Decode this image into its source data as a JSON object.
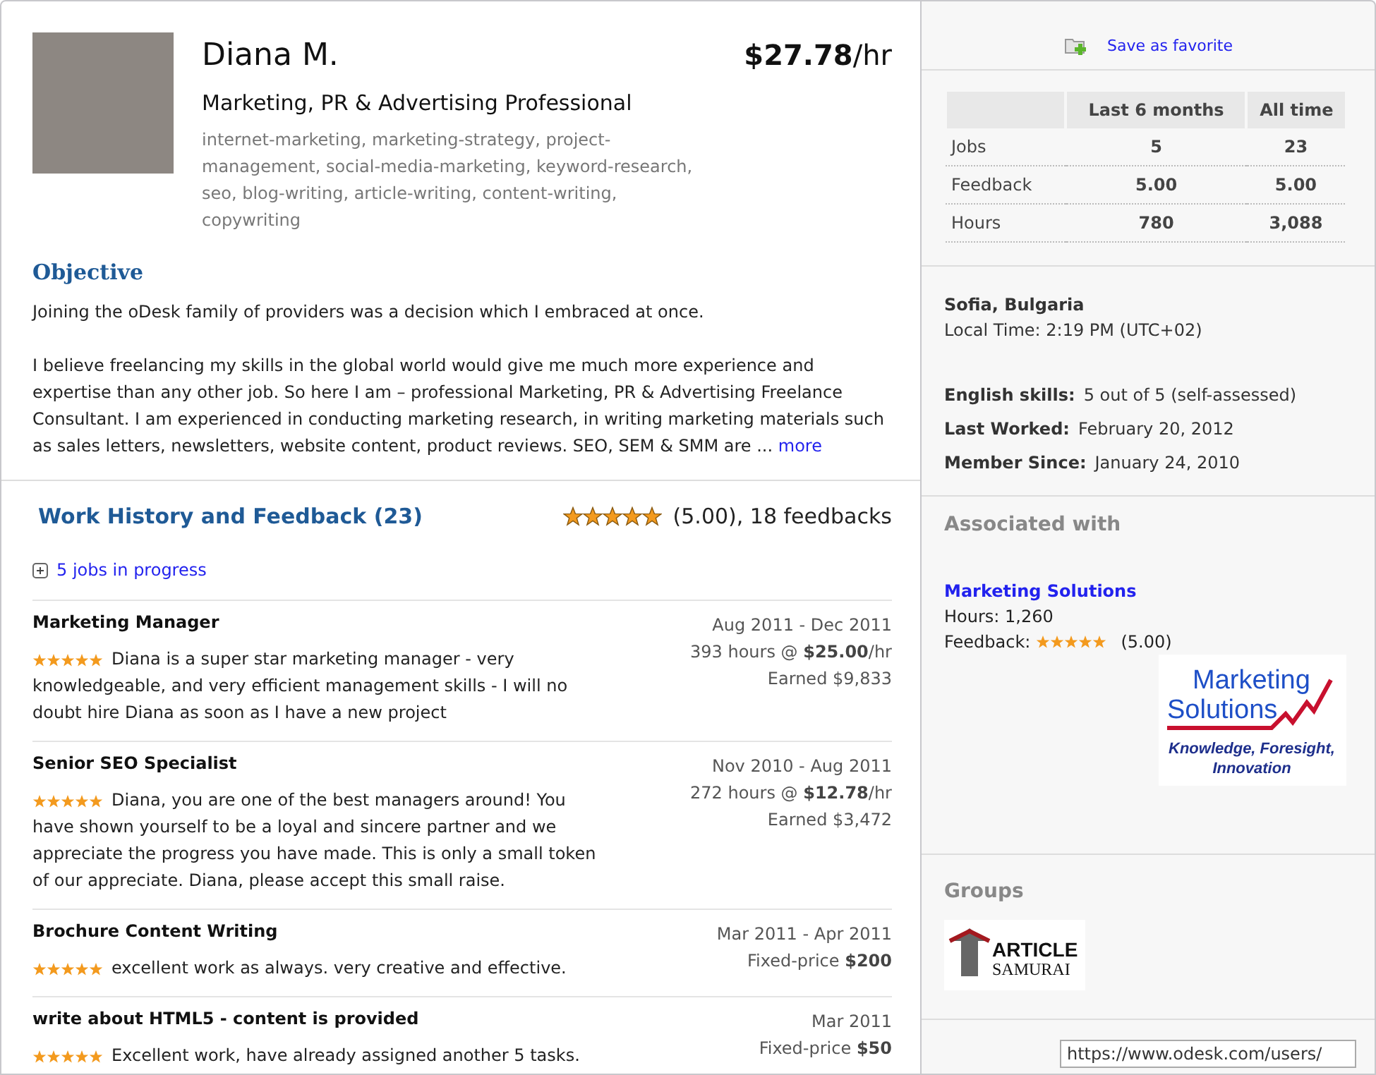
{
  "profile": {
    "name": "Diana M.",
    "title": "Marketing, PR & Advertising Professional",
    "skills": "internet-marketing, marketing-strategy, project-management, social-media-marketing, keyword-research, seo, blog-writing, article-writing, content-writing, copywriting",
    "rate_amount": "$27.78",
    "rate_unit": "/hr"
  },
  "objective": {
    "heading": "Objective",
    "paragraphs": [
      "Joining the oDesk family of providers was a decision which I embraced at once.",
      "I believe freelancing my skills in the global world would give me much more experience and expertise than any other job. So here I am – professional Marketing, PR & Advertising Freelance Consultant. I am experienced in conducting marketing research, in writing marketing materials such as sales letters, newsletters, website content, product reviews. SEO, SEM & SMM are  ..."
    ],
    "more_link": "more"
  },
  "work_history": {
    "heading": "Work History and Feedback (23)",
    "stars": 5,
    "rating_text": "(5.00), 18 feedbacks",
    "in_progress": "5 jobs in progress",
    "jobs": [
      {
        "title": "Marketing Manager",
        "stars": 5,
        "comment": "Diana is a super star marketing manager - very knowledgeable, and very efficient management skills - I will no doubt hire Diana as soon as I have a new project",
        "dates": "Aug 2011 - Dec 2011",
        "details": [
          "393 hours @ **$25.00**/hr",
          "Earned $9,833"
        ]
      },
      {
        "title": "Senior SEO Specialist",
        "stars": 5,
        "comment": "Diana, you are one of the best managers around! You have shown yourself to be a loyal and sincere partner and we appreciate the progress you have made. This is only a small token of our appreciate. Diana, please accept this small raise.",
        "dates": "Nov 2010 - Aug 2011",
        "details": [
          "272 hours @ **$12.78**/hr",
          "Earned $3,472"
        ]
      },
      {
        "title": "Brochure Content Writing",
        "stars": 5,
        "comment": "excellent work as always. very creative and effective.",
        "dates": "Mar 2011 - Apr 2011",
        "details": [
          "Fixed-price **$200**"
        ]
      },
      {
        "title": "write about HTML5 - content is provided",
        "stars": 5,
        "comment": "Excellent work, have already assigned another 5 tasks.",
        "dates": "Mar 2011",
        "details": [
          "Fixed-price **$50**"
        ]
      }
    ]
  },
  "sidebar": {
    "favorite_link": "Save as favorite",
    "stats": {
      "columns": [
        "Last 6 months",
        "All time"
      ],
      "rows": [
        {
          "label": "Jobs",
          "values": [
            "5",
            "23"
          ]
        },
        {
          "label": "Feedback",
          "values": [
            "5.00",
            "5.00"
          ]
        },
        {
          "label": "Hours",
          "values": [
            "780",
            "3,088"
          ]
        }
      ]
    },
    "location": "Sofia, Bulgaria",
    "local_time": "Local Time: 2:19 PM (UTC+02)",
    "facts": [
      {
        "label": "English skills:",
        "value": "5 out of 5 (self-assessed)"
      },
      {
        "label": "Last Worked:",
        "value": "February 20, 2012"
      },
      {
        "label": "Member Since:",
        "value": "January 24, 2010"
      }
    ],
    "associated": {
      "heading": "Associated with",
      "name": "Marketing Solutions",
      "hours": "Hours: 1,260",
      "feedback_label": "Feedback:",
      "stars": 5,
      "rating": "(5.00)",
      "logo": {
        "line1": "Marketing",
        "line2": "Solutions",
        "tagline1": "Knowledge, Foresight,",
        "tagline2": "Innovation"
      }
    },
    "groups": {
      "heading": "Groups",
      "logo": {
        "line1": "ARTICLE",
        "line2": "SAMURAI"
      }
    },
    "profile_link": {
      "value": "https://www.odesk.com/users/"
    }
  }
}
